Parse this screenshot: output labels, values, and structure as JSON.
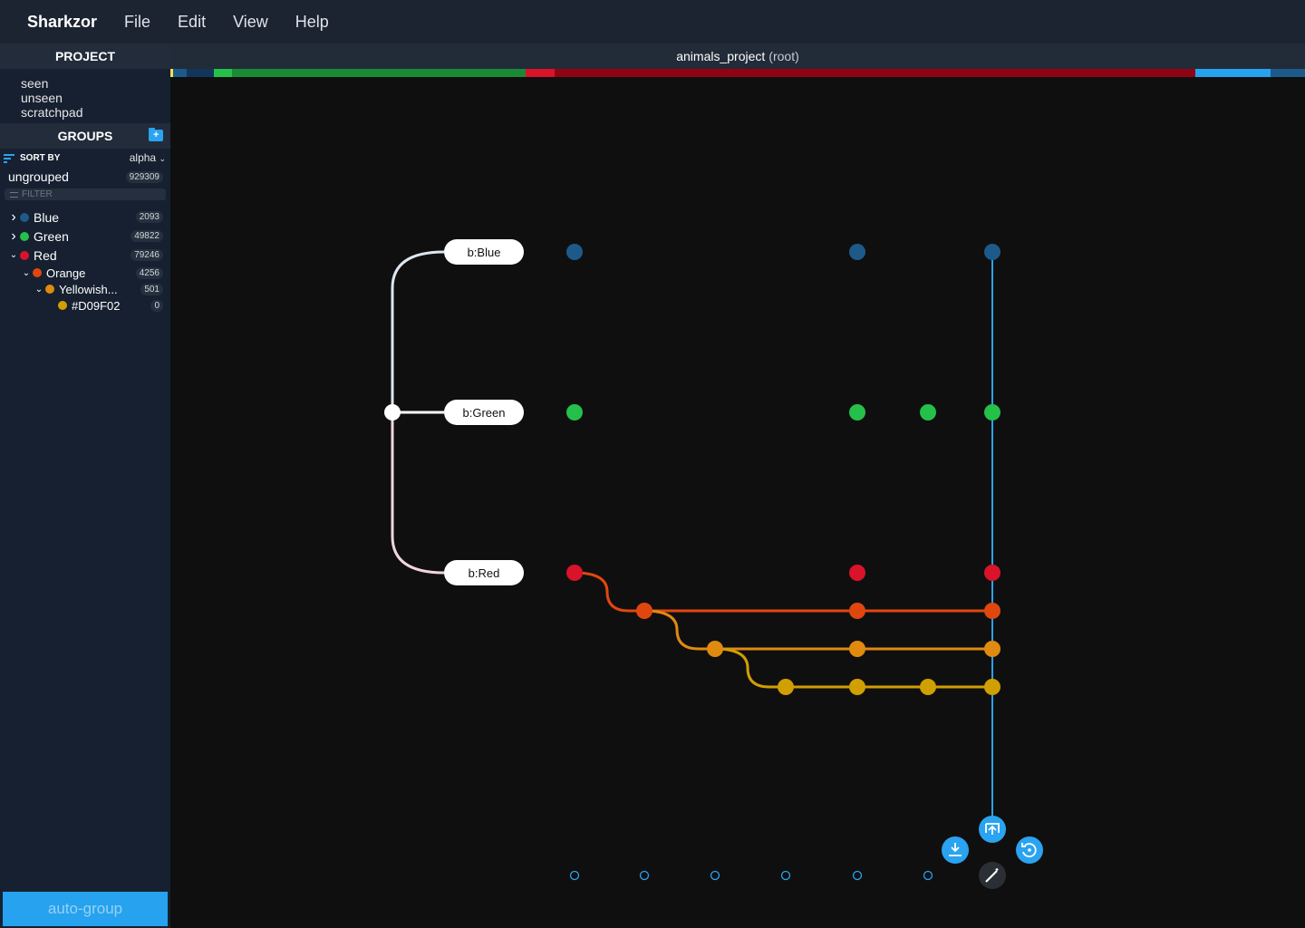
{
  "app": {
    "name": "Sharkzor"
  },
  "menu": [
    "File",
    "Edit",
    "View",
    "Help"
  ],
  "titlebar": {
    "project": "animals_project",
    "scope": "(root)"
  },
  "sidebar": {
    "project_header": "PROJECT",
    "project_items": [
      "seen",
      "unseen",
      "scratchpad"
    ],
    "groups_header": "GROUPS",
    "sort_label": "SORT BY",
    "sort_value": "alpha",
    "ungrouped": {
      "label": "ungrouped",
      "count": "929309"
    },
    "filter_placeholder": "FILTER",
    "groups": [
      {
        "label": "Blue",
        "count": "2093",
        "color": "#1d5a8a",
        "expanded": false,
        "level": 0
      },
      {
        "label": "Green",
        "count": "49822",
        "color": "#25c04a",
        "expanded": false,
        "level": 0
      },
      {
        "label": "Red",
        "count": "79246",
        "color": "#d8132a",
        "expanded": true,
        "level": 0
      },
      {
        "label": "Orange",
        "count": "4256",
        "color": "#e0470f",
        "expanded": true,
        "level": 1
      },
      {
        "label": "Yellowish...",
        "count": "501",
        "color": "#e08a10",
        "expanded": true,
        "level": 2
      },
      {
        "label": "#D09F02",
        "count": "0",
        "color": "#d09f02",
        "level": 3
      }
    ],
    "autogroup_label": "auto-group"
  },
  "colorbar": [
    {
      "color": "#f2e24a",
      "fraction": 0.002
    },
    {
      "color": "#1d5a8a",
      "fraction": 0.012
    },
    {
      "color": "#12355a",
      "fraction": 0.024
    },
    {
      "color": "#25c04a",
      "fraction": 0.016
    },
    {
      "color": "#1b8a36",
      "fraction": 0.259
    },
    {
      "color": "#d8132a",
      "fraction": 0.026
    },
    {
      "color": "#8e0414",
      "fraction": 0.564
    },
    {
      "color": "#26a2ee",
      "fraction": 0.067
    },
    {
      "color": "#1d5a8a",
      "fraction": 0.03
    }
  ],
  "graph": {
    "branches": [
      {
        "label": "b:Blue",
        "color": "#1d5a8a"
      },
      {
        "label": "b:Green",
        "color": "#25c04a"
      },
      {
        "label": "b:Red",
        "color": "#d8132a"
      }
    ],
    "sub_branch_colors": [
      "#d8132a",
      "#e0470f",
      "#e08a10",
      "#d09f02"
    ],
    "main_line_color": "#2aa3f0",
    "actions": [
      "download-icon",
      "publish-icon",
      "reset-icon",
      "magic-wand-icon"
    ]
  }
}
